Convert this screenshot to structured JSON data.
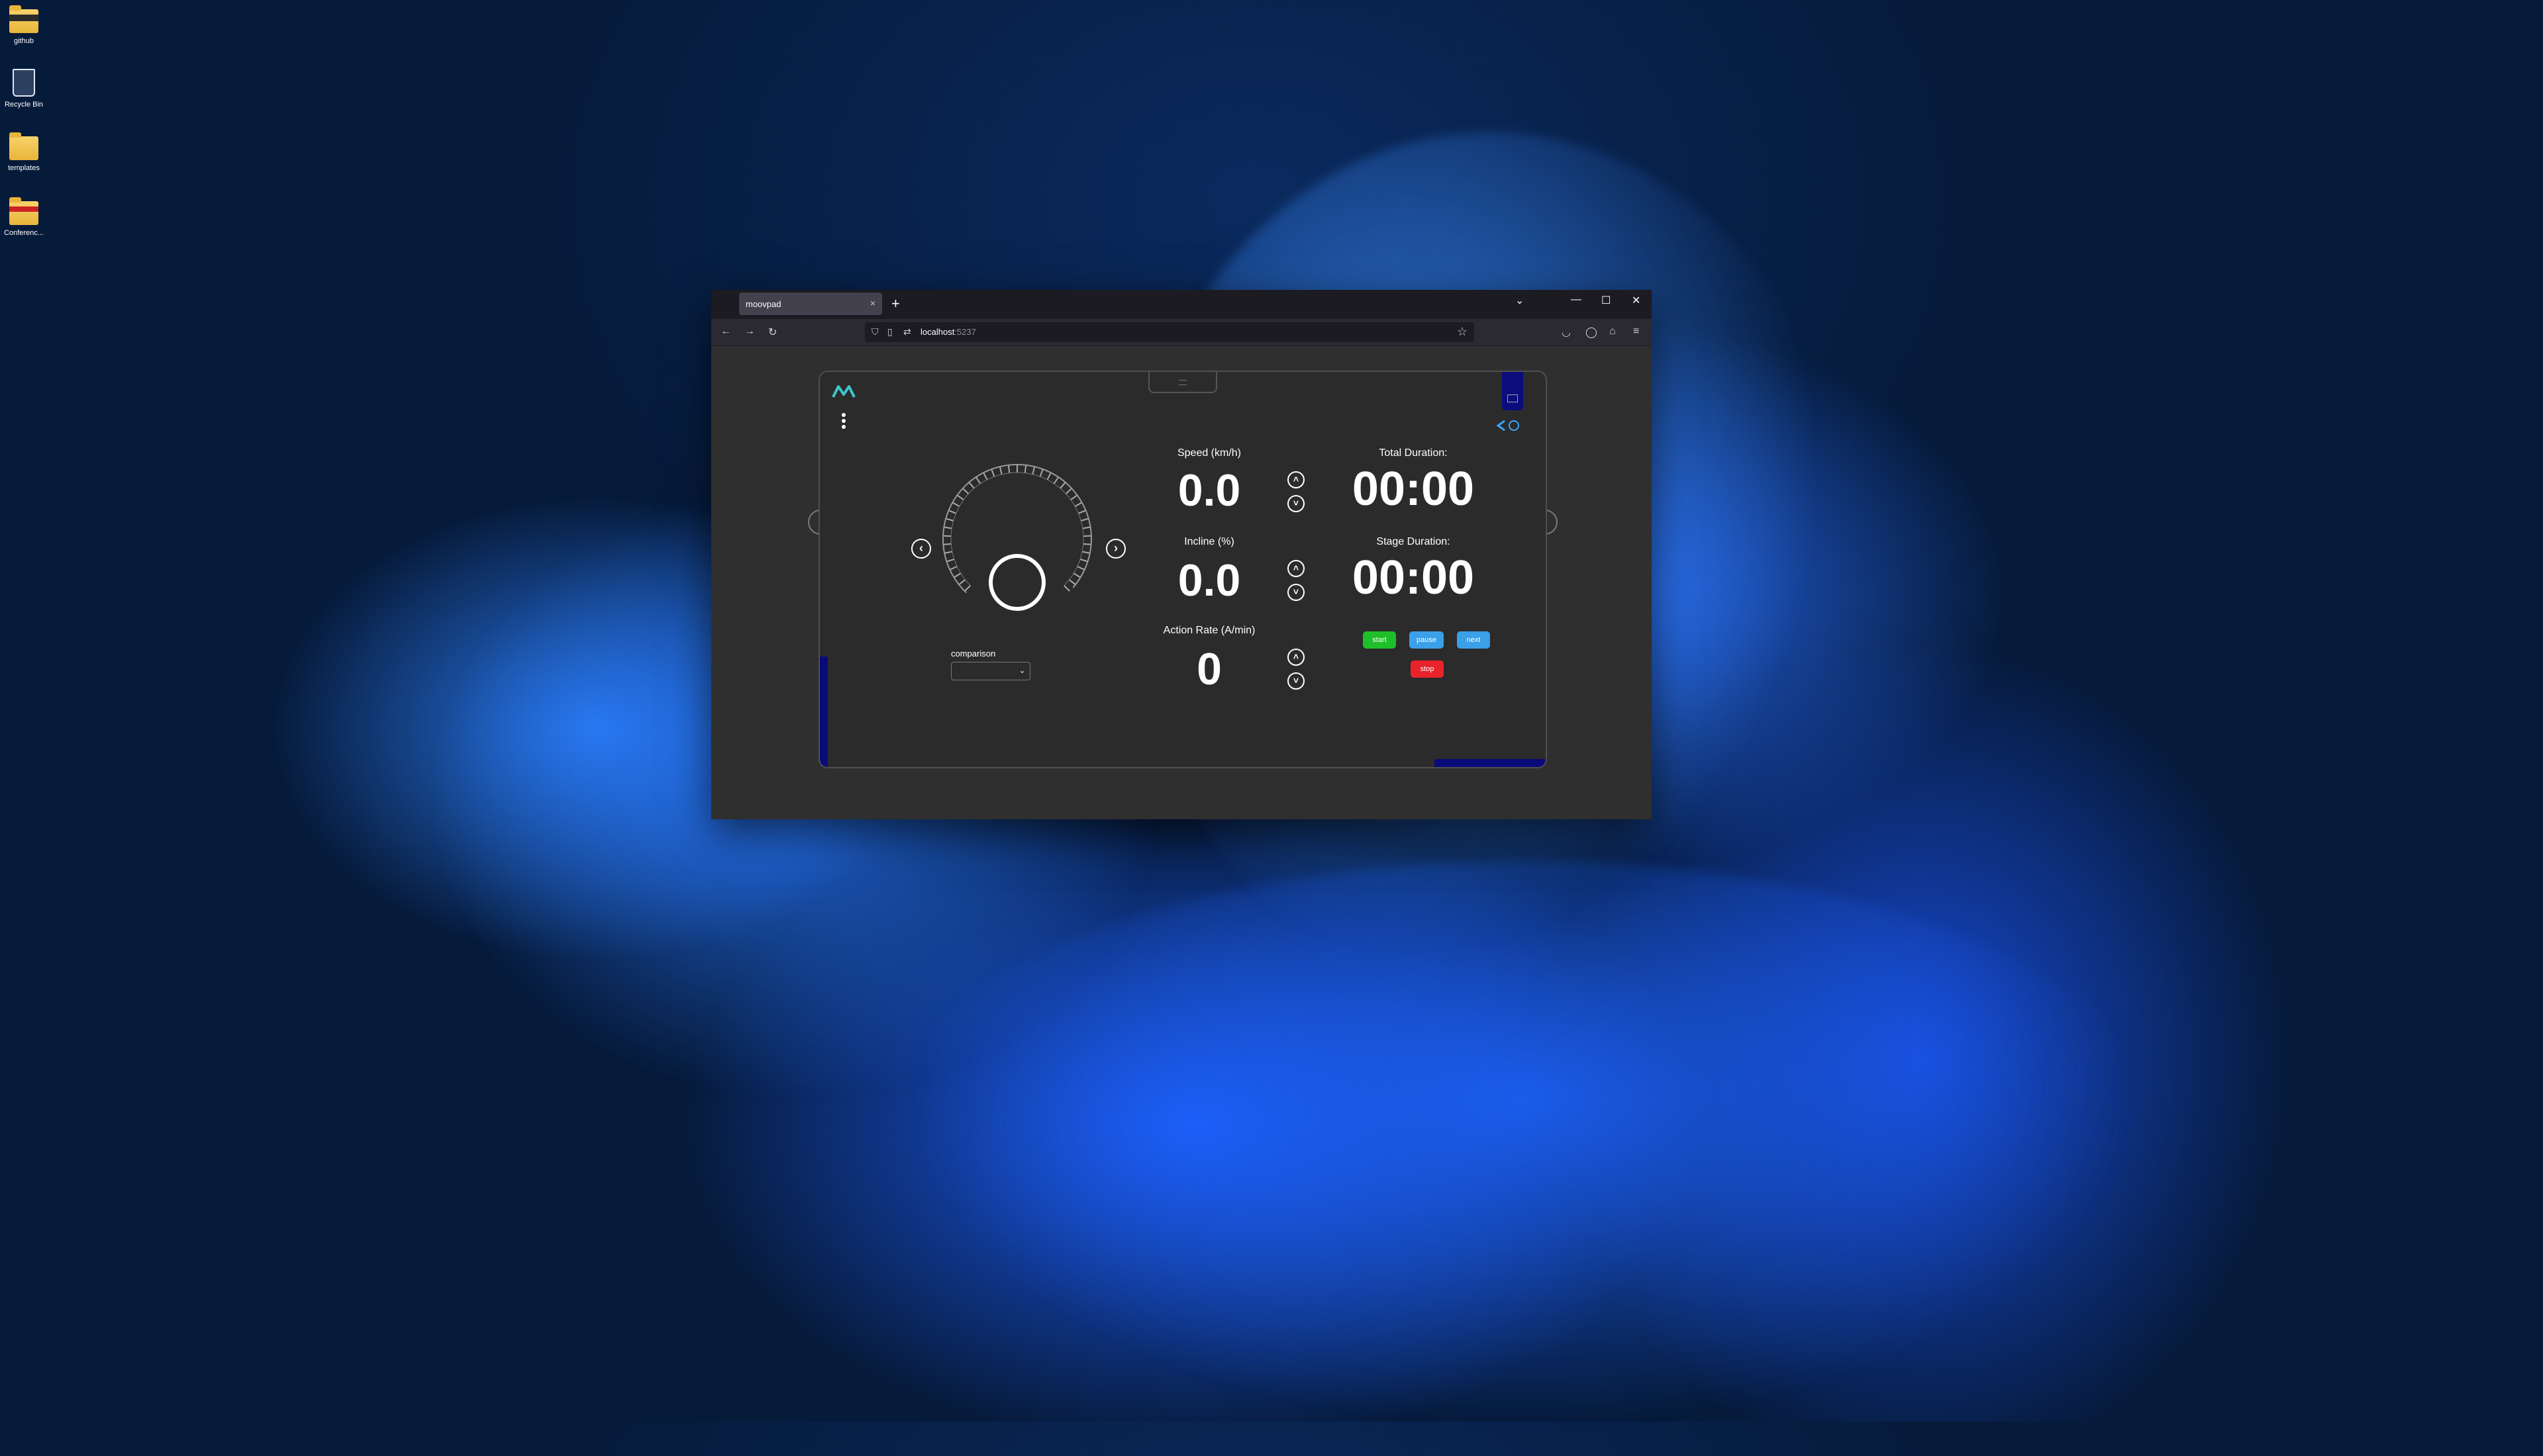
{
  "desktop": {
    "icons": [
      {
        "label": "github",
        "kind": "folder-dark"
      },
      {
        "label": "Recycle Bin",
        "kind": "recycle-bin"
      },
      {
        "label": "templates",
        "kind": "folder"
      },
      {
        "label": "Conferenc...",
        "kind": "folder-conf"
      }
    ]
  },
  "browser": {
    "tab_title": "moovpad",
    "tab_close": "×",
    "new_tab": "+",
    "list_tabs": "⌄",
    "minimize": "—",
    "maximize": "☐",
    "close": "✕",
    "url_host": "localhost",
    "url_port": ":5237",
    "back": "←",
    "forward": "→",
    "reload": "↻",
    "star": "☆",
    "pocket": "◡",
    "account": "◯",
    "extensions": "⌂",
    "menu": "≡"
  },
  "app": {
    "comparison_label": "comparison",
    "comparison_value": "",
    "dial_prev": "‹",
    "dial_next": "›",
    "page_prev": "‹",
    "page_next": "›",
    "speed": {
      "label": "Speed (km/h)",
      "value": "0.0"
    },
    "incline": {
      "label": "Incline (%)",
      "value": "0.0"
    },
    "action_rate": {
      "label": "Action Rate (A/min)",
      "value": "0"
    },
    "total_duration": {
      "label": "Total Duration:",
      "value": "00:00"
    },
    "stage_duration": {
      "label": "Stage Duration:",
      "value": "00:00"
    },
    "stepper_up": "˄",
    "stepper_down": "˅",
    "controls": {
      "start": "start",
      "pause": "pause",
      "next": "next",
      "stop": "stop"
    },
    "colors": {
      "start": "#1fbf2a",
      "pause": "#3aa0e8",
      "next": "#3aa0e8",
      "stop": "#e8232b",
      "accent_blue": "#0a0a7a",
      "logo": "#3ec6c8"
    }
  }
}
